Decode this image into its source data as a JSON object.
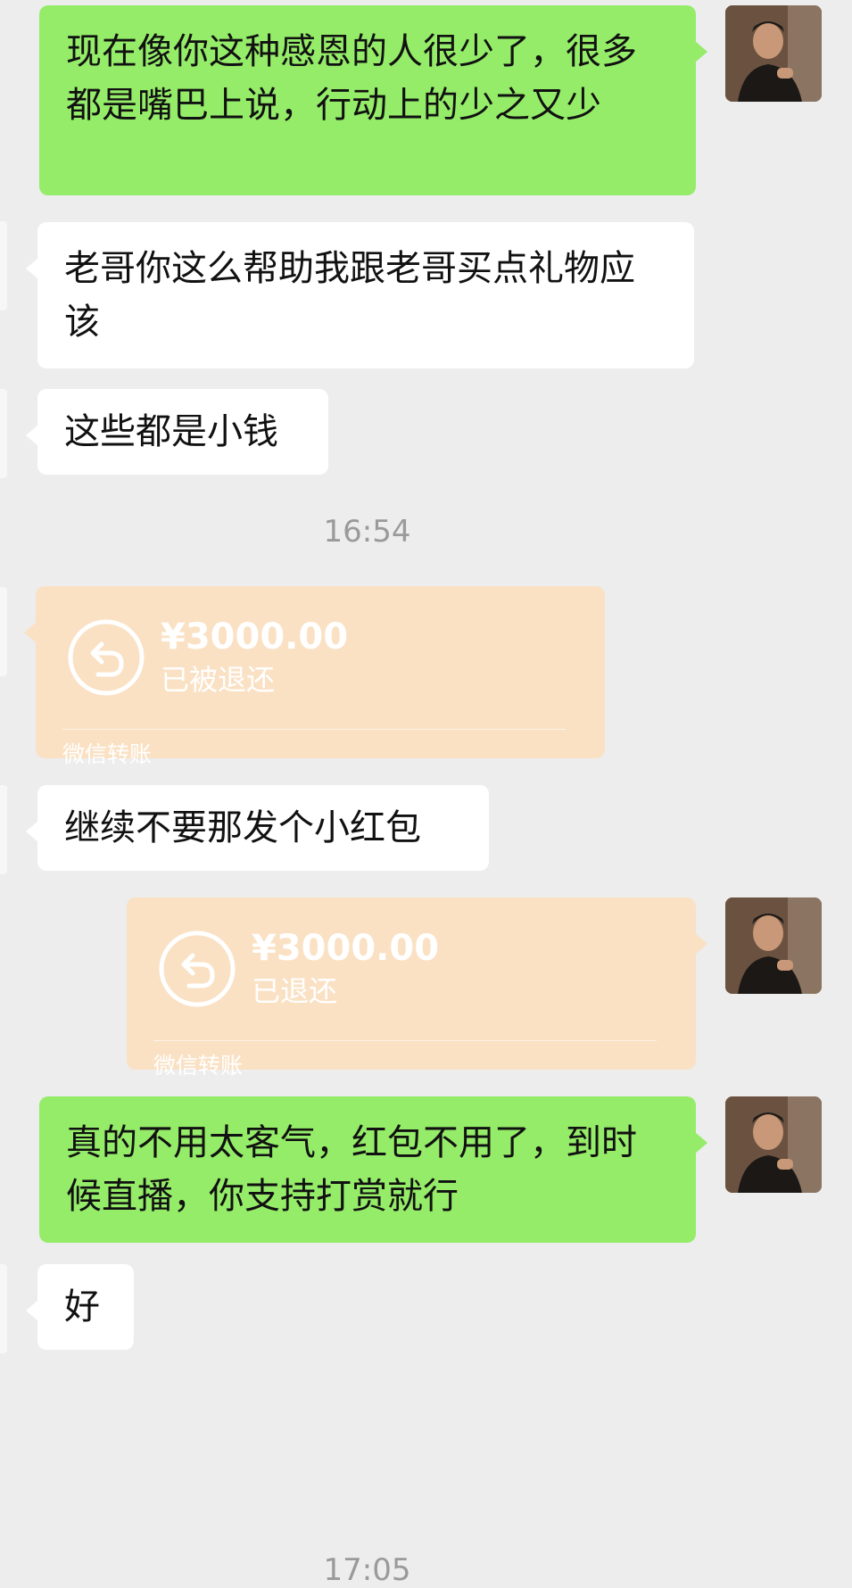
{
  "messages": [
    {
      "side": "me",
      "text": "现在像你这种感恩的人很少了，很多都是嘴巴上说，行动上的少之又少"
    },
    {
      "side": "other",
      "text": "老哥你这么帮助我跟老哥买点礼物应该"
    },
    {
      "side": "other",
      "text": "这些都是小钱"
    },
    {
      "side": "other",
      "text": "继续不要那发个小红包"
    },
    {
      "side": "me",
      "text": "真的不用太客气，红包不用了，到时候直播，你支持打赏就行"
    },
    {
      "side": "other",
      "text": "好"
    }
  ],
  "timestamps": [
    "16:54",
    "17:05"
  ],
  "transfers": [
    {
      "side": "other",
      "amount": "¥3000.00",
      "status": "已被退还",
      "source": "微信转账",
      "icon": "return-arrow-icon"
    },
    {
      "side": "me",
      "amount": "¥3000.00",
      "status": "已退还",
      "source": "微信转账",
      "icon": "return-arrow-icon"
    }
  ],
  "colors": {
    "background": "#ededed",
    "my_bubble": "#95ec69",
    "other_bubble": "#ffffff",
    "transfer_card": "#fae1c4",
    "timestamp": "#9a9a9a"
  }
}
